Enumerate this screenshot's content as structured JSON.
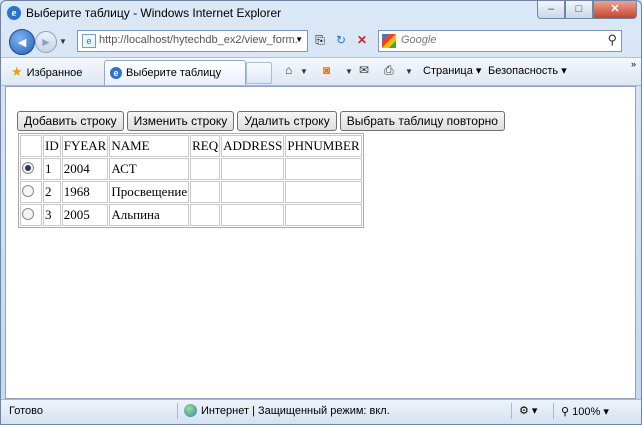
{
  "window": {
    "title": "Выберите таблицу - Windows Internet Explorer",
    "minimize": "–",
    "maximize": "□",
    "close": "✕"
  },
  "nav": {
    "back_icon": "◄",
    "forward_icon": "►",
    "address": "http://localhost/hytechdb_ex2/view_form.",
    "search_placeholder": "Google"
  },
  "favorites": {
    "label": "Избранное",
    "tab_title": "Выберите таблицу",
    "page_menu": "Страница",
    "safety_menu": "Безопасность",
    "more": "»"
  },
  "buttons": {
    "add": "Добавить строку",
    "edit": "Изменить строку",
    "delete": "Удалить строку",
    "reselect": "Выбрать таблицу повторно"
  },
  "table": {
    "headers": [
      "",
      "ID",
      "FYEAR",
      "NAME",
      "REQ",
      "ADDRESS",
      "PHNUMBER"
    ],
    "rows": [
      {
        "selected": true,
        "id": "1",
        "fyear": "2004",
        "name": "АСТ",
        "req": "",
        "address": "",
        "phnumber": ""
      },
      {
        "selected": false,
        "id": "2",
        "fyear": "1968",
        "name": "Просвещение",
        "req": "",
        "address": "",
        "phnumber": ""
      },
      {
        "selected": false,
        "id": "3",
        "fyear": "2005",
        "name": "Альпина",
        "req": "",
        "address": "",
        "phnumber": ""
      }
    ]
  },
  "status": {
    "text": "Готово",
    "zone": "Интернет | Защищенный режим: вкл.",
    "zoom": "100%"
  },
  "icons": {
    "ie": "ie-logo-icon",
    "star": "favorites-star-icon",
    "home": "home-icon",
    "feeds": "rss-icon",
    "mail": "mail-icon",
    "print": "print-icon",
    "search": "magnifier-icon"
  }
}
